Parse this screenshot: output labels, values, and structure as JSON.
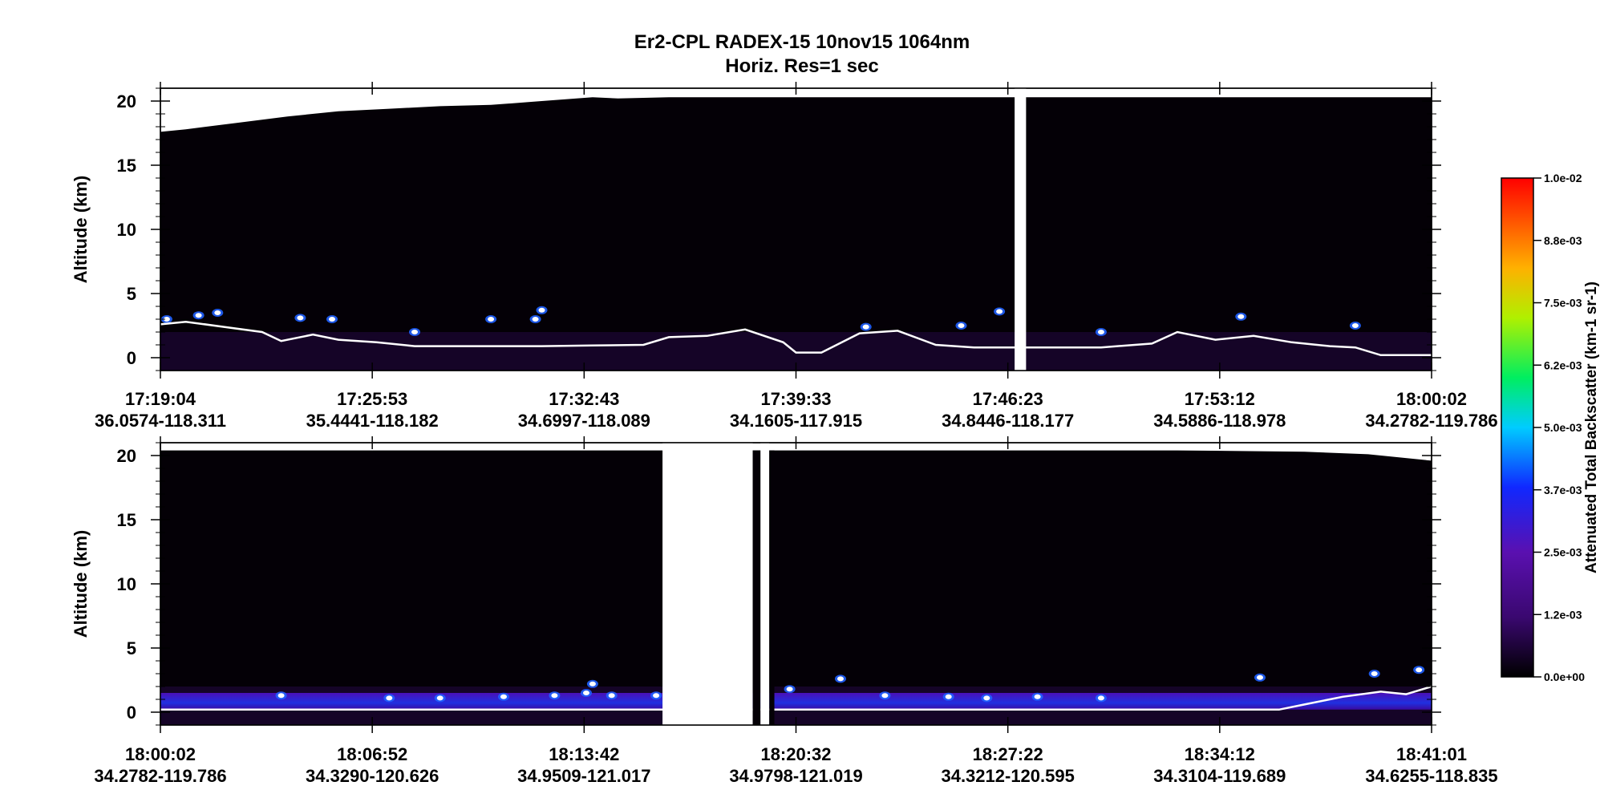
{
  "chart_data": {
    "title": "Er2-CPL  RADEX-15  10nov15  1064nm",
    "subtitle": "Horiz. Res=1 sec",
    "colorbar": {
      "label": "Attenuated Total Backscatter (km-1 sr-1)",
      "ticks": [
        "0.0e+00",
        "1.2e-03",
        "2.5e-03",
        "3.7e-03",
        "5.0e-03",
        "6.2e-03",
        "7.5e-03",
        "8.8e-03",
        "1.0e-02"
      ],
      "range": [
        0.0,
        0.01
      ],
      "colors": [
        "#000000",
        "#5a0aa0",
        "#1020ff",
        "#00ddff",
        "#00ee40",
        "#f8f000",
        "#ff8000",
        "#ff0000"
      ]
    },
    "panels": [
      {
        "type": "heatmap",
        "ylabel": "Altitude (km)",
        "ylim": [
          -1,
          21
        ],
        "yticks": [
          "0",
          "5",
          "10",
          "15",
          "20"
        ],
        "xticks": [
          {
            "time": "17:19:04",
            "loc": "36.0574-118.311"
          },
          {
            "time": "17:25:53",
            "loc": "35.4441-118.182"
          },
          {
            "time": "17:32:43",
            "loc": "34.6997-118.089"
          },
          {
            "time": "17:39:33",
            "loc": "34.1605-117.915"
          },
          {
            "time": "17:46:23",
            "loc": "34.8446-118.177"
          },
          {
            "time": "17:53:12",
            "loc": "34.5886-118.978"
          },
          {
            "time": "18:00:02",
            "loc": "34.2782-119.786"
          }
        ],
        "top_of_data": {
          "x": [
            0,
            0.02,
            0.06,
            0.1,
            0.14,
            0.18,
            0.22,
            0.26,
            0.3,
            0.34,
            0.36,
            0.4,
            1.0
          ],
          "alt": [
            17.6,
            17.8,
            18.3,
            18.8,
            19.2,
            19.4,
            19.6,
            19.7,
            20.0,
            20.3,
            20.2,
            20.3,
            20.3
          ]
        },
        "ground": {
          "x": [
            0,
            0.02,
            0.05,
            0.08,
            0.095,
            0.12,
            0.14,
            0.17,
            0.2,
            0.25,
            0.3,
            0.34,
            0.38,
            0.4,
            0.43,
            0.46,
            0.49,
            0.5,
            0.52,
            0.55,
            0.58,
            0.61,
            0.64,
            0.67,
            0.7,
            0.74,
            0.78,
            0.8,
            0.83,
            0.86,
            0.89,
            0.92,
            0.94,
            0.96,
            1.0
          ],
          "alt": [
            2.6,
            2.8,
            2.4,
            2.0,
            1.3,
            1.8,
            1.4,
            1.2,
            0.9,
            0.9,
            0.9,
            0.95,
            1.0,
            1.6,
            1.7,
            2.2,
            1.2,
            0.4,
            0.4,
            1.9,
            2.1,
            1.0,
            0.8,
            0.8,
            0.8,
            0.8,
            1.1,
            2.0,
            1.4,
            1.7,
            1.2,
            0.9,
            0.8,
            0.2,
            0.2
          ]
        },
        "clouds": [
          {
            "x": 0.005,
            "alt": 3.0
          },
          {
            "x": 0.03,
            "alt": 3.3
          },
          {
            "x": 0.045,
            "alt": 3.5
          },
          {
            "x": 0.11,
            "alt": 3.1
          },
          {
            "x": 0.135,
            "alt": 3.0
          },
          {
            "x": 0.2,
            "alt": 2.0
          },
          {
            "x": 0.26,
            "alt": 3.0
          },
          {
            "x": 0.295,
            "alt": 3.0
          },
          {
            "x": 0.3,
            "alt": 3.7
          },
          {
            "x": 0.555,
            "alt": 2.4
          },
          {
            "x": 0.63,
            "alt": 2.5
          },
          {
            "x": 0.66,
            "alt": 3.6
          },
          {
            "x": 0.74,
            "alt": 2.0
          },
          {
            "x": 0.85,
            "alt": 3.2
          },
          {
            "x": 0.94,
            "alt": 2.5
          }
        ],
        "gaps": [
          {
            "x0": 0.672,
            "x1": 0.681
          }
        ]
      },
      {
        "type": "heatmap",
        "ylabel": "Altitude (km)",
        "ylim": [
          -1,
          21
        ],
        "yticks": [
          "0",
          "5",
          "10",
          "15",
          "20"
        ],
        "xticks": [
          {
            "time": "18:00:02",
            "loc": "34.2782-119.786"
          },
          {
            "time": "18:06:52",
            "loc": "34.3290-120.626"
          },
          {
            "time": "18:13:42",
            "loc": "34.9509-121.017"
          },
          {
            "time": "18:20:32",
            "loc": "34.9798-121.019"
          },
          {
            "time": "18:27:22",
            "loc": "34.3212-120.595"
          },
          {
            "time": "18:34:12",
            "loc": "34.3104-119.689"
          },
          {
            "time": "18:41:01",
            "loc": "34.6255-118.835"
          }
        ],
        "top_of_data": {
          "x": [
            0,
            0.2,
            0.4,
            0.6,
            0.8,
            0.9,
            0.95,
            1.0
          ],
          "alt": [
            20.4,
            20.4,
            20.4,
            20.4,
            20.4,
            20.3,
            20.1,
            19.6
          ]
        },
        "ground": {
          "x": [
            0,
            0.2,
            0.39,
            0.47,
            0.55,
            0.65,
            0.75,
            0.8,
            0.88,
            0.9,
            0.93,
            0.96,
            0.98,
            1.0
          ],
          "alt": [
            0.2,
            0.2,
            0.2,
            0.2,
            0.2,
            0.2,
            0.2,
            0.2,
            0.2,
            0.6,
            1.2,
            1.6,
            1.4,
            2.0
          ]
        },
        "boundary_layer": {
          "top_alt": 1.5,
          "x_ranges": [
            [
              0.0,
              0.395
            ],
            [
              0.466,
              1.0
            ]
          ]
        },
        "clouds": [
          {
            "x": 0.095,
            "alt": 1.3
          },
          {
            "x": 0.18,
            "alt": 1.1
          },
          {
            "x": 0.22,
            "alt": 1.1
          },
          {
            "x": 0.27,
            "alt": 1.2
          },
          {
            "x": 0.31,
            "alt": 1.3
          },
          {
            "x": 0.335,
            "alt": 1.5
          },
          {
            "x": 0.34,
            "alt": 2.2
          },
          {
            "x": 0.355,
            "alt": 1.3
          },
          {
            "x": 0.39,
            "alt": 1.3
          },
          {
            "x": 0.495,
            "alt": 1.8
          },
          {
            "x": 0.535,
            "alt": 2.6
          },
          {
            "x": 0.57,
            "alt": 1.3
          },
          {
            "x": 0.62,
            "alt": 1.2
          },
          {
            "x": 0.65,
            "alt": 1.1
          },
          {
            "x": 0.69,
            "alt": 1.2
          },
          {
            "x": 0.74,
            "alt": 1.1
          },
          {
            "x": 0.865,
            "alt": 2.7
          },
          {
            "x": 0.955,
            "alt": 3.0
          },
          {
            "x": 0.99,
            "alt": 3.3
          }
        ],
        "gaps": [
          {
            "x0": 0.395,
            "x1": 0.466
          },
          {
            "x0": 0.472,
            "x1": 0.479
          }
        ],
        "black_columns": [
          {
            "x0": 0.466,
            "x1": 0.472
          },
          {
            "x0": 0.479,
            "x1": 0.483
          }
        ]
      }
    ]
  }
}
